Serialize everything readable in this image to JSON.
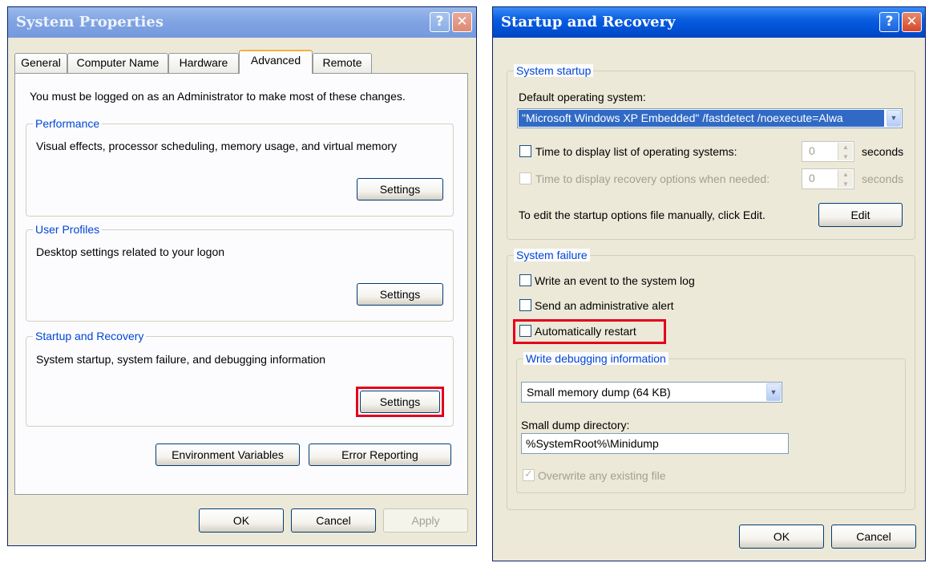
{
  "sysprops": {
    "title": "System Properties",
    "help_glyph": "?",
    "close_glyph": "✕",
    "tabs": [
      "General",
      "Computer Name",
      "Hardware",
      "Advanced",
      "Remote"
    ],
    "admin_note": "You must be logged on as an Administrator to make most of these changes.",
    "performance": {
      "legend": "Performance",
      "desc": "Visual effects, processor scheduling, memory usage, and virtual memory",
      "button": "Settings"
    },
    "user_profiles": {
      "legend": "User Profiles",
      "desc": "Desktop settings related to your logon",
      "button": "Settings"
    },
    "startup_recovery": {
      "legend": "Startup and Recovery",
      "desc": "System startup, system failure, and debugging information",
      "button": "Settings"
    },
    "env_button": "Environment Variables",
    "error_button": "Error Reporting",
    "ok": "OK",
    "cancel": "Cancel",
    "apply": "Apply"
  },
  "startup": {
    "title": "Startup and Recovery",
    "help_glyph": "?",
    "close_glyph": "✕",
    "system_startup": {
      "legend": "System startup",
      "default_os_label": "Default operating system:",
      "default_os_value": "\"Microsoft Windows XP Embedded\" /fastdetect /noexecute=Alwa",
      "time_os_label": "Time to display list of operating systems:",
      "time_os_value": "0",
      "time_recovery_label": "Time to display recovery options when needed:",
      "time_recovery_value": "0",
      "seconds": "seconds",
      "edit_note": "To edit the startup options file manually, click Edit.",
      "edit_button": "Edit"
    },
    "system_failure": {
      "legend": "System failure",
      "write_event": "Write an event to the system log",
      "send_alert": "Send an administrative alert",
      "auto_restart": "Automatically restart"
    },
    "debugging": {
      "legend": "Write debugging information",
      "dump_type": "Small memory dump (64 KB)",
      "dir_label": "Small dump directory:",
      "dir_value": "%SystemRoot%\\Minidump",
      "overwrite": "Overwrite any existing file"
    },
    "ok": "OK",
    "cancel": "Cancel"
  },
  "colors": {
    "highlight_box": "#e4001b",
    "title_blue": "#0052d6",
    "legend_blue": "#0046d5",
    "selection": "#316ac5"
  }
}
